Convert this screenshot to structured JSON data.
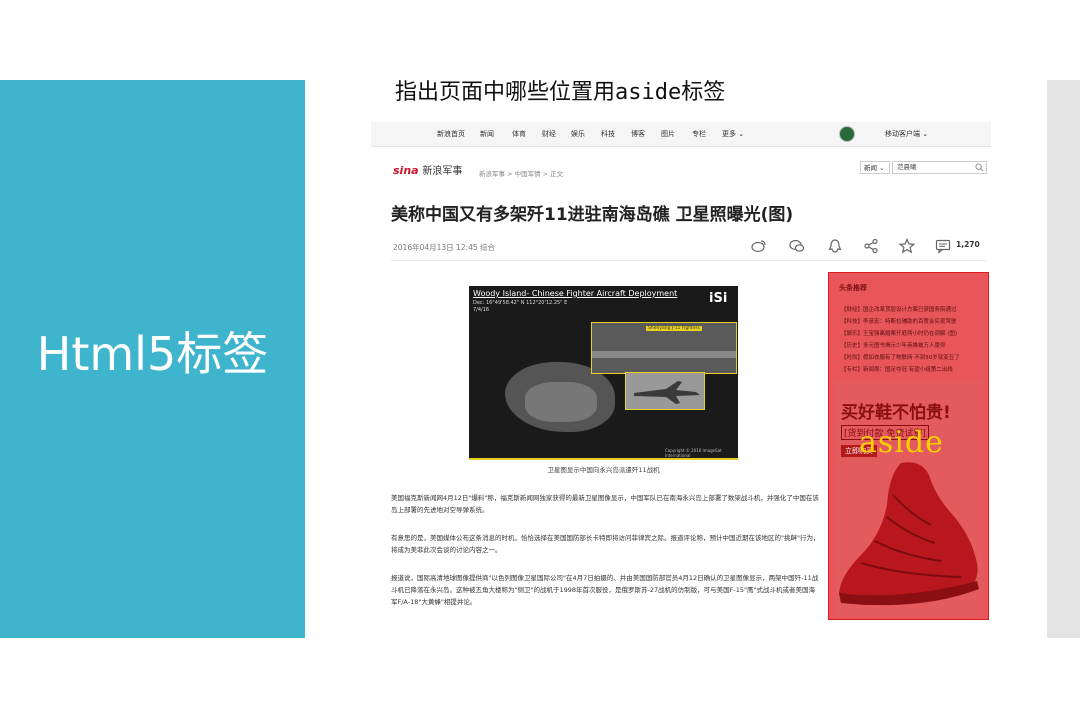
{
  "slide": {
    "side_title": "Html5标签",
    "heading_prefix": "指出页面中哪些位置用",
    "heading_code": "aside",
    "heading_suffix": "标签"
  },
  "screenshot": {
    "nav": {
      "items": [
        "新浪首页",
        "新闻",
        "体育",
        "财经",
        "娱乐",
        "科技",
        "博客",
        "图片",
        "专栏",
        "更多 ⌄"
      ],
      "mobile_label": "移动客户端 ⌄"
    },
    "site": {
      "logo_text": "sina",
      "logo_cn": "新浪军事",
      "breadcrumb": "新浪军事  >  中国军情  >  正文"
    },
    "search": {
      "select_value": "新闻 ⌄",
      "input_value": "范晨曦"
    },
    "article": {
      "headline": "美称中国又有多架歼11进驻南海岛礁 卫星照曝光(图)",
      "meta": "2016年04月13日  12:45   综合",
      "comment_count": "1,270",
      "photo": {
        "title": "Woody Island- Chinese Fighter Aircraft Deployment",
        "coords": "Dec: 16°49'58.42\" N  112°20'12.25\" E",
        "date": "7/4/16",
        "logo": "iSi",
        "inset_label": "Shenyang J-11 Fighters",
        "credit": "Copyright © 2016 ImageSat International"
      },
      "caption": "卫星图显示中国向永兴岛派遣歼11战机",
      "paragraphs": [
        "美国福克斯新闻网4月12日\"爆料\"称，福克斯新闻网独家获得的最新卫星图像显示，中国军队已在南海永兴岛上部署了数架战斗机，并强化了中国在该岛上部署的先进地对空导弹系统。",
        "有意思的是，美国媒体公布这条消息的时机，恰恰选择在美国国防部长卡特即将访问菲律宾之际。报道评论称，预计中国近期在该地区的\"挑衅\"行为，将成为美菲此次会谈的讨论内容之一。",
        "报道说，国际高清地球图像提供商\"以色列图像卫星国际公司\"在4月7日拍摄的、并由美国国防部官员4月12日确认的卫星图像显示，两架中国歼-11战斗机已降落在永兴岛。这种被五角大楼称为\"侧卫\"的战机于1998年首次服役，是俄罗斯苏-27战机的仿制版，可与美国F-15\"鹰\"式战斗机或者美国海军F/A-18\"大黄蜂\"相提并论。"
      ]
    },
    "aside": {
      "heading": "头条推荐",
      "items": [
        "【财经】国企改革顶层设计方案已获国务院通过",
        "【科技】李彦宏：特斯拉辅助的百度会实现驾驶",
        "【娱乐】王宝强离婚案开庭两小时仍在调解 (图)",
        "【历史】多元图书揭示少年英雄被万人景仰",
        "【时尚】假如衣服有了物联网 不到50岁就变丑了",
        "【专栏】新闻周：国足夺冠 有望小组第二出线"
      ],
      "ad_title": "买好鞋不怕贵!",
      "ad_sub": "[货到付款 免费试穿]",
      "ad_button": "立即购买",
      "label": "aside"
    },
    "colors": {
      "slide_blue": "#3fb4cd",
      "aside_red": "#d81920",
      "label_yellow": "#ffd000"
    }
  }
}
